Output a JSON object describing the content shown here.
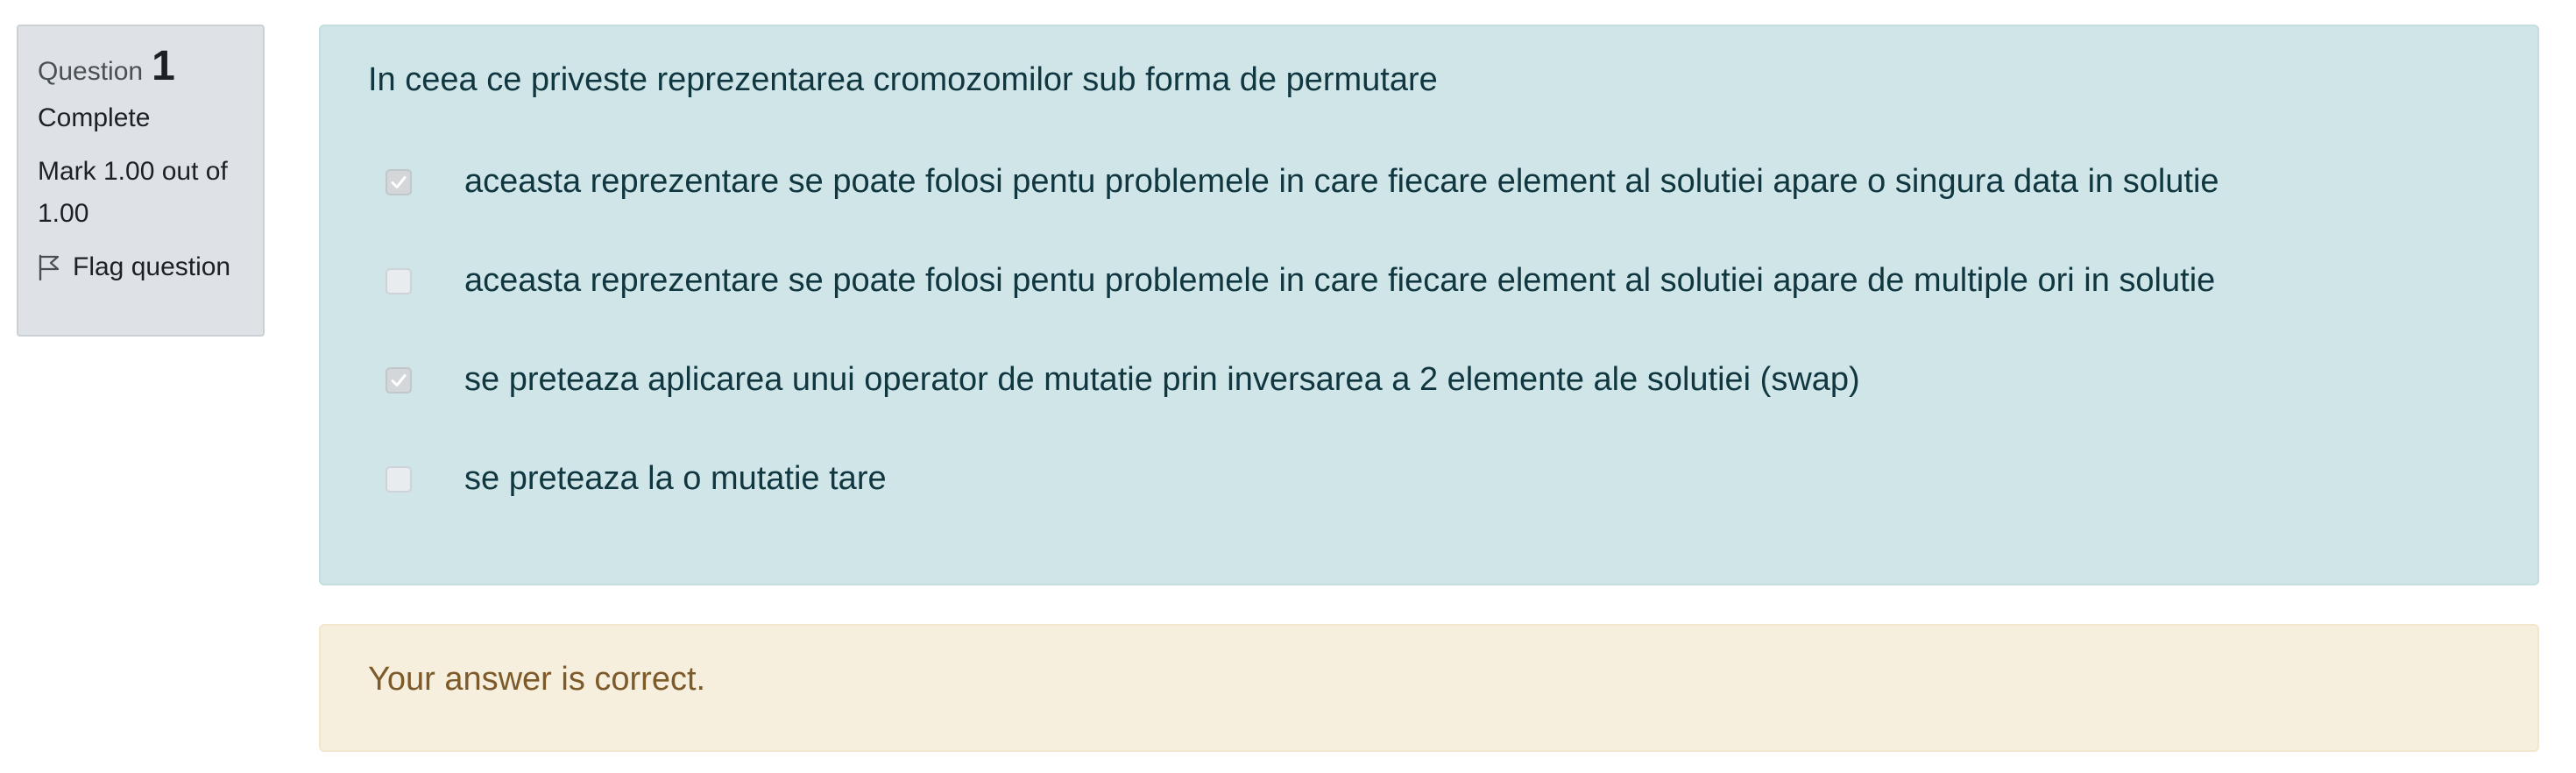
{
  "info": {
    "question_label": "Question",
    "question_number": "1",
    "state": "Complete",
    "mark_line1": "Mark 1.00 out of",
    "mark_line2": "1.00",
    "flag_label": "Flag question"
  },
  "question": {
    "text": "In ceea ce priveste reprezentarea cromozomilor sub forma de permutare",
    "options": [
      {
        "label": "aceasta reprezentare se poate folosi pentu problemele in care fiecare element al solutiei apare o singura data in solutie",
        "checked": true
      },
      {
        "label": "aceasta reprezentare se poate folosi pentu problemele in care fiecare element al solutiei apare de multiple ori in solutie",
        "checked": false
      },
      {
        "label": "se preteaza aplicarea unui operator de mutatie prin inversarea a 2 elemente ale solutiei (swap)",
        "checked": true
      },
      {
        "label": "se preteaza la o mutatie tare",
        "checked": false
      }
    ]
  },
  "feedback": {
    "text": "Your answer is correct."
  },
  "colors": {
    "info_bg": "#dee2e6",
    "question_bg": "#cfe5e8",
    "question_text": "#103640",
    "feedback_bg": "#f7efdd",
    "feedback_text": "#7d5a29"
  },
  "icons": {
    "flag": "flag-icon",
    "check": "checkmark-icon"
  }
}
